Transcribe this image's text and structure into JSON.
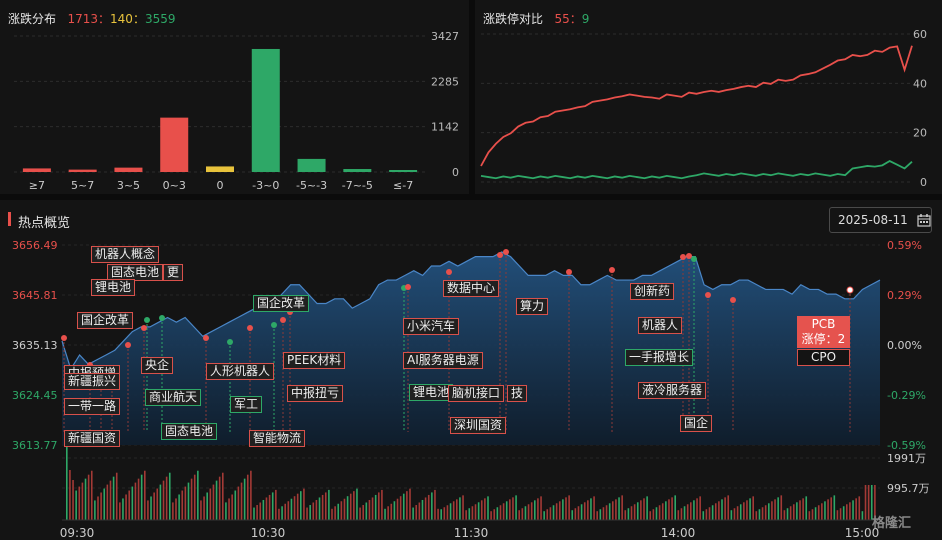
{
  "dist": {
    "title": "涨跌分布",
    "up": "1713",
    "flat": "140",
    "down": "3559",
    "sep": "：",
    "colors": {
      "up": "#e8504b",
      "flat": "#e8c33c",
      "down": "#2ea867"
    }
  },
  "ratio": {
    "title": "涨跌停对比",
    "up": "55",
    "down": "9"
  },
  "hot": {
    "title": "热点概览",
    "date": "2025-08-11",
    "calendar_icon": "calendar-icon"
  },
  "pcb": {
    "name": "PCB",
    "limit": "涨停：2",
    "next": "CPO"
  },
  "tags": [
    {
      "t": "机器人概念",
      "c": "r"
    },
    {
      "t": "固态电池",
      "c": "r"
    },
    {
      "t": "更",
      "c": "r"
    },
    {
      "t": "锂电池",
      "c": "r"
    },
    {
      "t": "国企改革",
      "c": "r"
    },
    {
      "t": "中报预增",
      "c": "r"
    },
    {
      "t": "新疆振兴",
      "c": "r"
    },
    {
      "t": "一带一路",
      "c": "r"
    },
    {
      "t": "新疆国资",
      "c": "r"
    },
    {
      "t": "央企",
      "c": "r"
    },
    {
      "t": "商业航天",
      "c": "g"
    },
    {
      "t": "固态电池",
      "c": "g"
    },
    {
      "t": "人形机器人",
      "c": "r"
    },
    {
      "t": "军工",
      "c": "g"
    },
    {
      "t": "智能物流",
      "c": "r"
    },
    {
      "t": "国企改革",
      "c": "g"
    },
    {
      "t": "PEEK材料",
      "c": "r"
    },
    {
      "t": "中报扭亏",
      "c": "r"
    },
    {
      "t": "数据中心",
      "c": "r"
    },
    {
      "t": "算力",
      "c": "r"
    },
    {
      "t": "小米汽车",
      "c": "r"
    },
    {
      "t": "AI服务器电源",
      "c": "r"
    },
    {
      "t": "锂电池",
      "c": "g"
    },
    {
      "t": "脑机接口",
      "c": "r"
    },
    {
      "t": "技",
      "c": "r"
    },
    {
      "t": "深圳国资",
      "c": "r"
    },
    {
      "t": "创新药",
      "c": "r"
    },
    {
      "t": "机器人",
      "c": "r"
    },
    {
      "t": "一手报增长",
      "c": "g"
    },
    {
      "t": "液冷服务器",
      "c": "r"
    },
    {
      "t": "国企",
      "c": "r"
    }
  ],
  "chart_data": [
    {
      "type": "bar",
      "title": "涨跌分布",
      "categories": [
        "≥7",
        "5~7",
        "3~5",
        "0~3",
        "0",
        "-3~0",
        "-5~-3",
        "-7~-5",
        "≤-7"
      ],
      "values": [
        90,
        60,
        110,
        1370,
        140,
        3100,
        330,
        75,
        40
      ],
      "colors": [
        "#e8504b",
        "#e8504b",
        "#e8504b",
        "#e8504b",
        "#e8c33c",
        "#2ea867",
        "#2ea867",
        "#2ea867",
        "#2ea867"
      ],
      "yticks": [
        "3427",
        "2285",
        "1142",
        "0"
      ],
      "ylim": [
        0,
        3427
      ]
    },
    {
      "type": "line",
      "title": "涨跌停对比",
      "yticks": [
        "60",
        "40",
        "20",
        "0"
      ],
      "ylim": [
        0,
        60
      ],
      "series": [
        {
          "color": "#e8504b",
          "values": [
            6,
            12,
            16,
            18,
            20,
            22,
            24,
            25,
            26,
            27,
            28,
            29,
            30,
            30,
            31,
            32,
            33,
            34,
            34,
            35,
            35,
            35,
            35,
            34,
            34,
            35,
            35,
            35,
            36,
            36,
            36,
            37,
            37,
            37,
            38,
            38,
            39,
            39,
            40,
            40,
            41,
            41,
            42,
            43,
            44,
            44,
            46,
            48,
            49,
            50,
            51,
            51,
            52,
            53,
            53,
            54,
            55,
            46,
            55
          ]
        },
        {
          "color": "#2ea867",
          "values": [
            2,
            2,
            2,
            2,
            2,
            2,
            2,
            2,
            2,
            2,
            2,
            2,
            2,
            2,
            2,
            2,
            2,
            2,
            2,
            2,
            2,
            2,
            2,
            2,
            2,
            2,
            2,
            2,
            2,
            3,
            3,
            3,
            3,
            3,
            3,
            3,
            3,
            3,
            3,
            3,
            3,
            3,
            3,
            3,
            3,
            3,
            3,
            3,
            3,
            3,
            5,
            6,
            7,
            6,
            7,
            8,
            7,
            6,
            8
          ]
        }
      ]
    },
    {
      "type": "area",
      "title": "热点概览",
      "yticks": [
        "3656.49",
        "3645.81",
        "3635.13",
        "3624.45",
        "3613.77"
      ],
      "right_ticks": [
        "0.59%",
        "0.29%",
        "0.00%",
        "-0.29%",
        "-0.59%"
      ],
      "ylim": [
        3613.77,
        3656.49
      ],
      "xticks": [
        "09:30",
        "10:30",
        "11:30",
        "14:00",
        "15:00"
      ],
      "volume_ticks": [
        "1991万",
        "995.7万"
      ],
      "values": [
        3636,
        3630,
        3633,
        3631,
        3632,
        3633,
        3634,
        3636,
        3638,
        3639,
        3639,
        3640,
        3641,
        3640,
        3641,
        3639,
        3637,
        3638,
        3639,
        3640,
        3641,
        3642,
        3643,
        3645,
        3644,
        3646,
        3648,
        3648,
        3646,
        3644,
        3644,
        3645,
        3645,
        3643,
        3644,
        3645,
        3648,
        3649,
        3649,
        3650,
        3651,
        3650,
        3652,
        3652,
        3653,
        3652,
        3653,
        3654,
        3654,
        3654,
        3655,
        3654,
        3652,
        3650,
        3650,
        3650,
        3651,
        3650,
        3650,
        3648,
        3648,
        3649,
        3650,
        3649,
        3649,
        3649,
        3650,
        3650,
        3651,
        3652,
        3653,
        3654,
        3654,
        3648,
        3647,
        3648,
        3648,
        3649,
        3649,
        3648,
        3647,
        3647,
        3647,
        3646,
        3648,
        3647,
        3647,
        3646,
        3646,
        3645,
        3645,
        3647,
        3648,
        3649
      ]
    }
  ]
}
